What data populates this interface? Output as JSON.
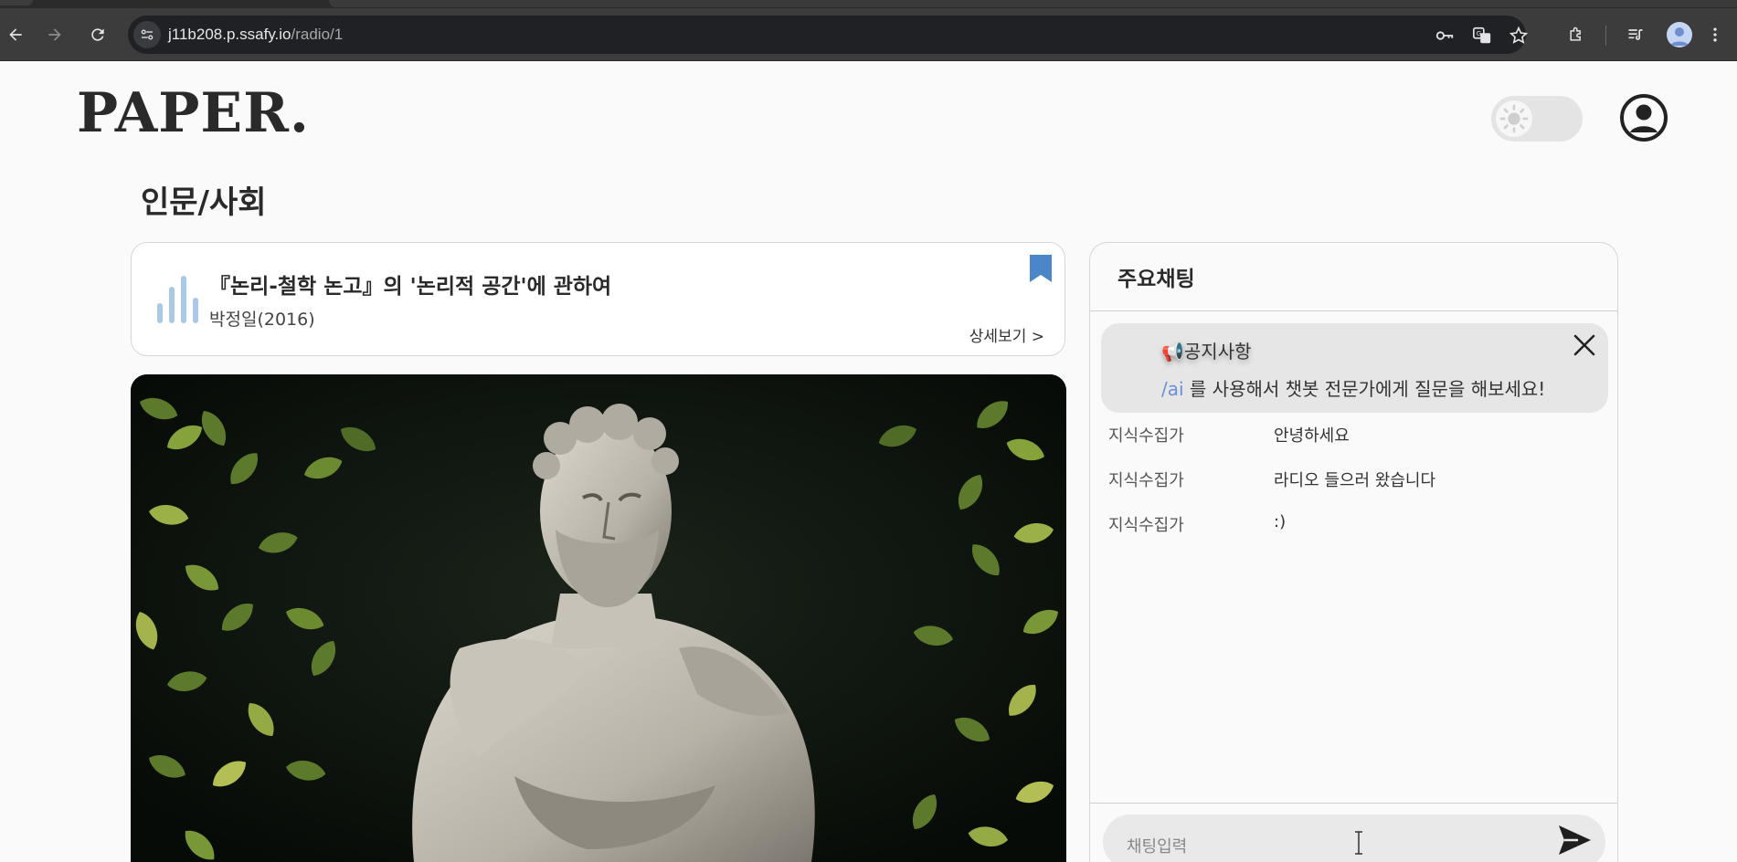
{
  "browser": {
    "url_host": "j11b208.p.ssafy.io",
    "url_path": "/radio/1",
    "icons": [
      "back-icon",
      "forward-icon",
      "reload-icon",
      "site-info-icon",
      "password-key-icon",
      "translate-icon",
      "star-icon",
      "extensions-icon",
      "media-control-icon",
      "profile-avatar-icon",
      "menu-dots-icon"
    ]
  },
  "header": {
    "logo": "PAPER.",
    "theme_icon": "sun-icon",
    "profile_icon": "user-circle-icon"
  },
  "page": {
    "category": "인문/사회"
  },
  "radio": {
    "title": "『논리-철학 논고』의 '논리적 공간'에 관하여",
    "author": "박정일(2016)",
    "detail_link": "상세보기 >",
    "bookmark_color": "#4a86c8",
    "bars_color": "#a9c9e6"
  },
  "chat": {
    "title": "주요채팅",
    "notice": {
      "title": "📢공지사항",
      "command": "/ai",
      "body": " 를 사용해서 챗봇 전문가에게 질문을 해보세요!"
    },
    "messages": [
      {
        "user": "지식수집가",
        "text": "안녕하세요"
      },
      {
        "user": "지식수집가",
        "text": "라디오 들으러 왔습니다"
      },
      {
        "user": "지식수집가",
        "text": ":)"
      }
    ],
    "input_placeholder": "채팅입력"
  }
}
